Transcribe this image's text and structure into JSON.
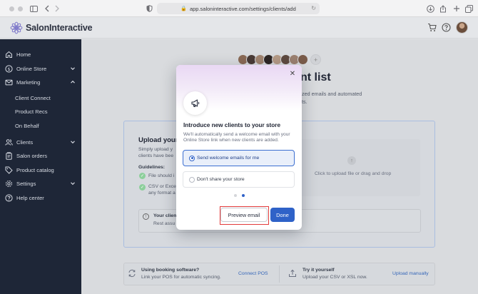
{
  "browser": {
    "url": "app.saloninteractive.com/settings/clients/add",
    "icons": [
      "sidebar-toggle-icon",
      "back-icon",
      "forward-icon",
      "shield-icon",
      "lock-icon",
      "reload-icon",
      "download-icon",
      "share-icon",
      "new-tab-icon",
      "tabs-icon"
    ]
  },
  "header": {
    "brand": "SalonInteractive",
    "icons": [
      "cart-icon",
      "help-icon",
      "avatar"
    ]
  },
  "sidebar": {
    "items": [
      {
        "label": "Home",
        "icon": "home-icon"
      },
      {
        "label": "Online Store",
        "icon": "store-icon",
        "chevron": "down"
      },
      {
        "label": "Marketing",
        "icon": "mail-icon",
        "chevron": "up"
      },
      {
        "label": "Client Connect"
      },
      {
        "label": "Product Recs"
      },
      {
        "label": "On Behalf"
      },
      {
        "label": "Clients",
        "icon": "users-icon",
        "chevron": "down"
      },
      {
        "label": "Salon orders",
        "icon": "clipboard-icon"
      },
      {
        "label": "Product catalog",
        "icon": "tag-icon"
      },
      {
        "label": "Settings",
        "icon": "gear-icon",
        "chevron": "down"
      },
      {
        "label": "Help center",
        "icon": "question-icon"
      }
    ]
  },
  "background": {
    "title_fragment": "nt list",
    "sub1_fragment": "zed emails and automated",
    "sub2_fragment": "ts.",
    "upload_title": "Upload your",
    "upload_desc1": "Simply upload y",
    "upload_desc2": "clients have bee",
    "guidelines_label": "Guidelines:",
    "guideline1": "File should i",
    "guideline2a": "CSV or Exce",
    "guideline2b": "any format a",
    "dropzone_text": "Click to upload file or drag and drop",
    "info_title": "Your client",
    "info_desc": "Rest assu",
    "bottom": {
      "left_title": "Using booking software?",
      "left_desc": "Link your POS for automatic syncing.",
      "left_link": "Connect POS",
      "right_title": "Try it yourself",
      "right_desc": "Upload your CSV or XSL now.",
      "right_link": "Upload manually"
    }
  },
  "modal": {
    "title": "Introduce new clients to your store",
    "desc1": "We'll automatically send a welcome email with your",
    "desc2": "Online Store link when new clients are added.",
    "options": [
      {
        "label": "Send welcome emails for me",
        "selected": true
      },
      {
        "label": "Don't share your store",
        "selected": false
      }
    ],
    "pagination": {
      "current": 2,
      "total": 2
    },
    "preview_button": "Preview email",
    "done_button": "Done",
    "close_icon": "close-icon",
    "hero_icon": "megaphone-icon"
  },
  "colors": {
    "accent": "#2f62c8",
    "sidebar_bg": "#1e2637",
    "highlight": "#e23b3b"
  }
}
